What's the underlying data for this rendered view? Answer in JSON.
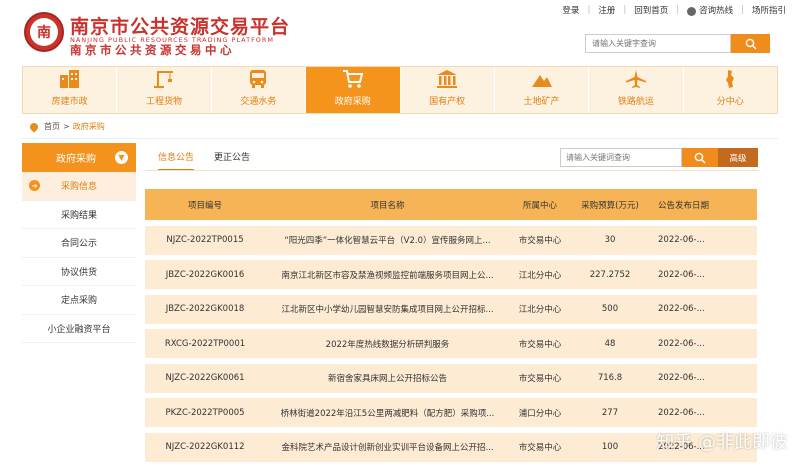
{
  "header": {
    "logo_cn": "南京市公共资源交易平台",
    "logo_en": "NANJING PUBLIC RESOURCES TRADING PLATFORM",
    "logo_cn2": "南京市公共资源交易中心",
    "links": {
      "login": "登录",
      "register": "注册",
      "home": "回到首页",
      "hotline": "咨询热线",
      "guide": "场所指引"
    },
    "search_placeholder": "请输入关键字查询"
  },
  "nav": {
    "items": [
      {
        "label": "房建市政",
        "icon": "building-icon"
      },
      {
        "label": "工程货物",
        "icon": "crane-icon"
      },
      {
        "label": "交通水务",
        "icon": "bus-icon"
      },
      {
        "label": "政府采购",
        "icon": "cart-icon"
      },
      {
        "label": "国有产权",
        "icon": "bank-icon"
      },
      {
        "label": "土地矿产",
        "icon": "mountain-icon"
      },
      {
        "label": "铁路航运",
        "icon": "plane-icon"
      },
      {
        "label": "分中心",
        "icon": "map-icon"
      }
    ],
    "active_index": 3
  },
  "breadcrumb": {
    "home": "首页",
    "separator": ">",
    "current": "政府采购"
  },
  "sidebar": {
    "header": "政府采购",
    "items": [
      "采购信息",
      "采购结果",
      "合同公示",
      "协议供货",
      "定点采购",
      "小企业融资平台"
    ]
  },
  "tabs": [
    "信息公告",
    "更正公告"
  ],
  "main_search": {
    "placeholder": "请输入关键词查询",
    "advanced": "高级"
  },
  "table": {
    "headers": [
      "项目编号",
      "项目名称",
      "所属中心",
      "采购预算(万元)",
      "公告发布日期"
    ],
    "rows": [
      [
        "NJZC-2022TP0015",
        "“阳光四季”一体化智慧云平台（V2.0）宣传服务网上...",
        "市交易中心",
        "30",
        "2022-06-..."
      ],
      [
        "JBZC-2022GK0016",
        "南京江北新区市容及禁渔视频监控前端服务项目网上公...",
        "江北分中心",
        "227.2752",
        "2022-06-..."
      ],
      [
        "JBZC-2022GK0018",
        "江北新区中小学幼儿园智慧安防集成项目网上公开招标...",
        "江北分中心",
        "500",
        "2022-06-..."
      ],
      [
        "RXCG-2022TP0001",
        "2022年度热线数据分析研判服务",
        "市交易中心",
        "48",
        "2022-06-..."
      ],
      [
        "NJZC-2022GK0061",
        "新宿舍家具床网上公开招标公告",
        "市交易中心",
        "716.8",
        "2022-06-..."
      ],
      [
        "PKZC-2022TP0005",
        "桥林街道2022年沿江5公里两减肥料（配方肥）采购项...",
        "浦口分中心",
        "277",
        "2022-06-..."
      ],
      [
        "NJZC-2022GK0112",
        "金科院艺术产品设计创新创业实训平台设备网上公开招...",
        "市交易中心",
        "100",
        "2022-06-..."
      ]
    ]
  },
  "watermark": "知乎 @非此即彼",
  "colors": {
    "accent": "#f4941c",
    "brand_red": "#c9332e",
    "row_bg": "#fdebd3",
    "header_bg": "#f6b456"
  }
}
